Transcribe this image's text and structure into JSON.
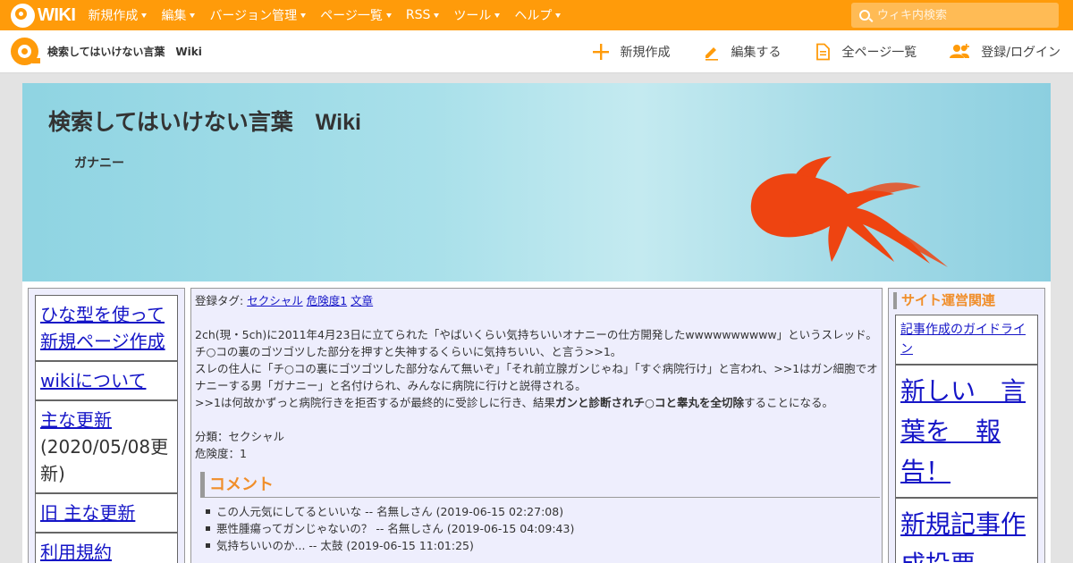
{
  "topbar": {
    "logo_text": "WIKI",
    "menu": [
      {
        "label": "新規作成"
      },
      {
        "label": "編集"
      },
      {
        "label": "バージョン管理"
      },
      {
        "label": "ページ一覧"
      },
      {
        "label": "RSS"
      },
      {
        "label": "ツール"
      },
      {
        "label": "ヘルプ"
      }
    ],
    "search_placeholder": "ウィキ内検索"
  },
  "subbar": {
    "site_name": "検索してはいけない言葉　Wiki",
    "actions": [
      {
        "label": "新規作成",
        "icon": "plus-icon"
      },
      {
        "label": "編集する",
        "icon": "pencil-icon"
      },
      {
        "label": "全ページ一覧",
        "icon": "document-icon"
      },
      {
        "label": "登録/ログイン",
        "icon": "users-icon"
      }
    ]
  },
  "banner": {
    "title": "検索してはいけない言葉　Wiki",
    "subtitle": "ガナニー"
  },
  "left_nav": {
    "items": [
      {
        "label": "ひな型を使って新規ページ作成"
      },
      {
        "label": "wikiについて"
      },
      {
        "label": "主な更新",
        "note": "(2020/05/08更新)"
      },
      {
        "label": "旧 主な更新"
      },
      {
        "label": "利用規約"
      }
    ]
  },
  "main": {
    "tags_label": "登録タグ:",
    "tags": [
      "セクシャル",
      "危険度1",
      "文章"
    ],
    "para1": "2ch(現・5ch)に2011年4月23日に立てられた「やばいくらい気持ちいいオナニーの仕方開発したwwwwwwwwww」というスレッド。",
    "para2": "チ○コの裏のゴツゴツした部分を押すと失神するくらいに気持ちいい、と言う>>1。",
    "para3": "スレの住人に「チ○コの裏にゴツゴツした部分なんて無いぞ」「それ前立腺ガンじゃね」「すぐ病院行け」と言われ、>>1はガン細胞でオナニーする男「ガナニー」と名付けられ、みんなに病院に行けと説得される。",
    "para4_pre": ">>1は何故かずっと病院行きを拒否するが最終的に受診しに行き、結果",
    "para4_bold": "ガンと診断されチ○コと睾丸を全切除",
    "para4_post": "することになる。",
    "category": "分類：セクシャル",
    "danger": "危険度：1",
    "comment_heading": "コメント",
    "comments": [
      "この人元気にしてるといいな -- 名無しさん (2019-06-15 02:27:08)",
      "悪性腫瘍ってガンじゃないの？ -- 名無しさん (2019-06-15 04:09:43)",
      "気持ちいいのか... -- 太鼓 (2019-06-15 11:01:25)"
    ]
  },
  "right_nav": {
    "heading": "サイト運営関連",
    "items": [
      {
        "label": "記事作成のガイドライン"
      },
      {
        "label": "新しい　言葉を　報告！"
      },
      {
        "label": "新規記事作成投票"
      }
    ]
  },
  "colors": {
    "brand_orange": "#ff9b0a",
    "heading_orange": "#f08e2a",
    "link_blue": "#1515c7",
    "panel_bg": "#eeeefd",
    "fish": "#ee4411"
  }
}
